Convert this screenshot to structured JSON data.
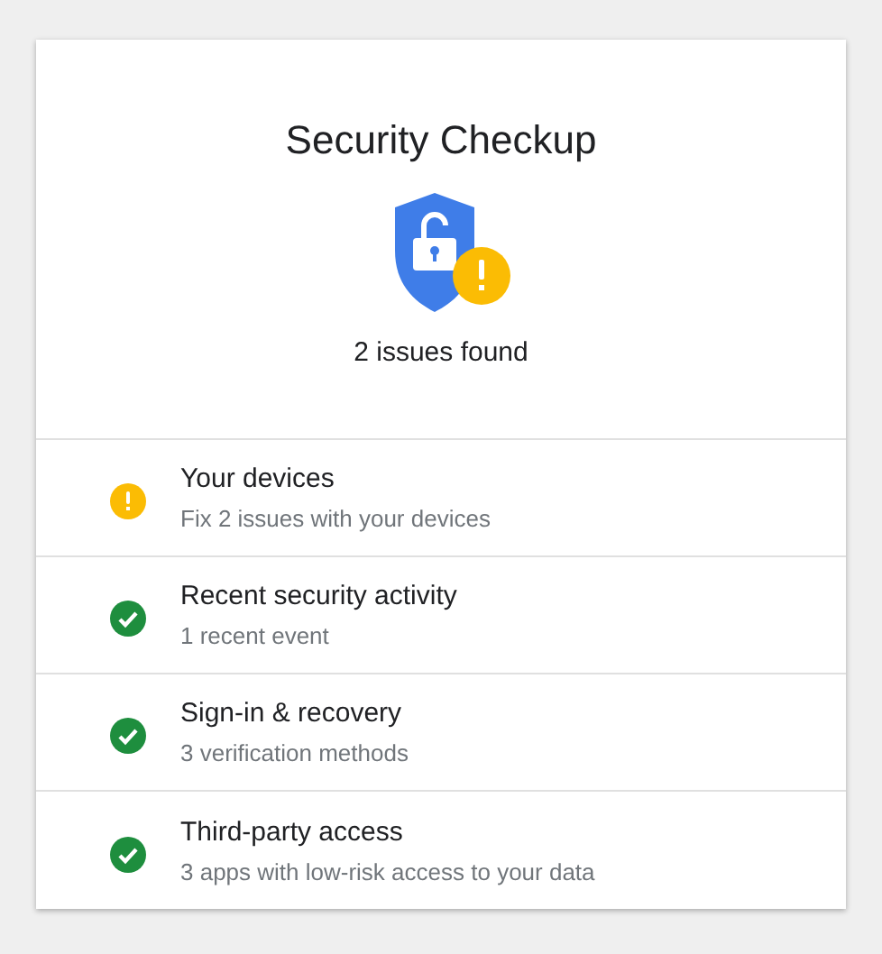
{
  "card": {
    "title": "Security Checkup",
    "summary": "2 issues found"
  },
  "items": [
    {
      "kind": "warning",
      "title": "Your devices",
      "subtitle": "Fix 2 issues with your devices"
    },
    {
      "kind": "ok",
      "title": "Recent security activity",
      "subtitle": "1 recent event"
    },
    {
      "kind": "ok",
      "title": "Sign-in & recovery",
      "subtitle": "3 verification methods"
    },
    {
      "kind": "ok",
      "title": "Third-party access",
      "subtitle": "3 apps with low-risk access to your data"
    }
  ]
}
